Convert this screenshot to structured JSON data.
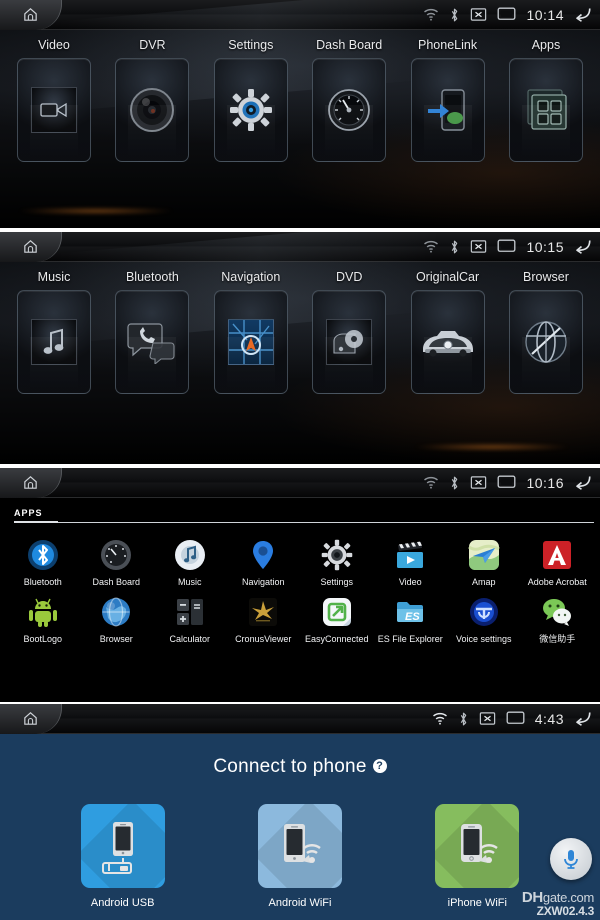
{
  "device": {
    "name": "android-car-head-unit",
    "screens": 4
  },
  "statusbar": {
    "home_icon": "home-icon",
    "icons": [
      "wifi-icon",
      "bluetooth-icon",
      "mute-x-icon",
      "screen-icon"
    ],
    "back_icon": "back-arrow-icon",
    "times": [
      "10:14",
      "10:15",
      "10:16",
      "4:43"
    ]
  },
  "home_page_1": {
    "tiles": [
      {
        "label": "Video",
        "icon": "camcorder-icon"
      },
      {
        "label": "DVR",
        "icon": "camera-lens-icon"
      },
      {
        "label": "Settings",
        "icon": "gear-icon"
      },
      {
        "label": "Dash Board",
        "icon": "gauge-icon"
      },
      {
        "label": "PhoneLink",
        "icon": "phone-link-icon"
      },
      {
        "label": "Apps",
        "icon": "grid-apps-icon"
      }
    ]
  },
  "home_page_2": {
    "tiles": [
      {
        "label": "Music",
        "icon": "music-note-icon"
      },
      {
        "label": "Bluetooth",
        "icon": "phone-handset-icon"
      },
      {
        "label": "Navigation",
        "icon": "map-pin-icon"
      },
      {
        "label": "DVD",
        "icon": "dvd-disc-icon"
      },
      {
        "label": "OriginalCar",
        "icon": "car-icon"
      },
      {
        "label": "Browser",
        "icon": "globe-icon"
      }
    ]
  },
  "app_drawer": {
    "tab_label": "APPS",
    "apps": [
      {
        "label": "Bluetooth",
        "icon": "bluetooth-app-icon",
        "color": "#1f8ae0"
      },
      {
        "label": "Dash Board",
        "icon": "dashboard-app-icon",
        "color": "#555a60"
      },
      {
        "label": "Music",
        "icon": "music-app-icon",
        "color": "#e9eef4"
      },
      {
        "label": "Navigation",
        "icon": "navigation-app-icon",
        "color": "#2a7de1"
      },
      {
        "label": "Settings",
        "icon": "settings-app-icon",
        "color": "#d7dade"
      },
      {
        "label": "Video",
        "icon": "video-app-icon",
        "color": "#3aa8dd"
      },
      {
        "label": "Amap",
        "icon": "amap-app-icon",
        "color": "#cfe0a8"
      },
      {
        "label": "Adobe Acrobat",
        "icon": "acrobat-app-icon",
        "color": "#cc2127"
      },
      {
        "label": "BootLogo",
        "icon": "bootlogo-app-icon",
        "color": "#9ac93c"
      },
      {
        "label": "Browser",
        "icon": "browser-app-icon",
        "color": "#2d7cc4"
      },
      {
        "label": "Calculator",
        "icon": "calculator-app-icon",
        "color": "#3b4046"
      },
      {
        "label": "CronusViewer",
        "icon": "cronusviewer-app-icon",
        "color": "#caa03a"
      },
      {
        "label": "EasyConnected",
        "icon": "easyconnected-app-icon",
        "color": "#52b24a"
      },
      {
        "label": "ES File Explorer",
        "icon": "esfile-app-icon",
        "color": "#3f9fd4"
      },
      {
        "label": "Voice settings",
        "icon": "voice-settings-app-icon",
        "color": "#1a4fd1"
      },
      {
        "label": "微信助手",
        "icon": "wechat-app-icon",
        "color": "#7bc856"
      }
    ]
  },
  "connect_to_phone": {
    "title": "Connect to phone",
    "help_glyph": "?",
    "help_icon": "help-icon",
    "options": [
      {
        "label": "Android USB",
        "icon": "phone-usb-icon",
        "color": "#2f9de0"
      },
      {
        "label": "Android WiFi",
        "icon": "phone-wifi-icon",
        "color": "#8cb9dd"
      },
      {
        "label": "iPhone WiFi",
        "icon": "iphone-wifi-icon",
        "color": "#86bd5e"
      }
    ],
    "mic_icon": "microphone-icon",
    "background_color": "#1b3c5e"
  },
  "watermark": {
    "main_bold": "DH",
    "main_rest": "gate.com",
    "sub": "ZXW02.4.3"
  }
}
